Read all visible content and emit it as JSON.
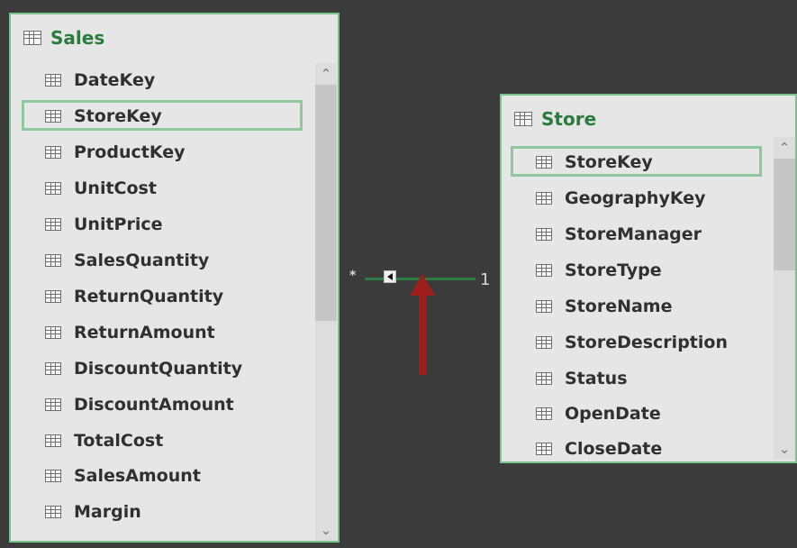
{
  "sales_table": {
    "title": "Sales",
    "fields": [
      {
        "label": "DateKey"
      },
      {
        "label": "StoreKey",
        "selected": true
      },
      {
        "label": "ProductKey"
      },
      {
        "label": "UnitCost"
      },
      {
        "label": "UnitPrice"
      },
      {
        "label": "SalesQuantity"
      },
      {
        "label": "ReturnQuantity"
      },
      {
        "label": "ReturnAmount"
      },
      {
        "label": "DiscountQuantity"
      },
      {
        "label": "DiscountAmount"
      },
      {
        "label": "TotalCost"
      },
      {
        "label": "SalesAmount"
      },
      {
        "label": "Margin"
      }
    ]
  },
  "store_table": {
    "title": "Store",
    "fields": [
      {
        "label": "StoreKey",
        "selected": true
      },
      {
        "label": "GeographyKey"
      },
      {
        "label": "StoreManager"
      },
      {
        "label": "StoreType"
      },
      {
        "label": "StoreName"
      },
      {
        "label": "StoreDescription"
      },
      {
        "label": "Status"
      },
      {
        "label": "OpenDate"
      },
      {
        "label": "CloseDate"
      }
    ]
  },
  "relationship": {
    "from_cardinality": "*",
    "to_cardinality": "1"
  },
  "icons": {
    "table": "table-grid-icon",
    "field": "field-grid-icon",
    "scroll_up": "chevron-up-icon",
    "scroll_down": "chevron-down-icon",
    "filter_direction": "filter-direction-icon",
    "annotation_arrow": "red-arrow-icon"
  },
  "colors": {
    "canvas": "#3b3b3b",
    "table_bg": "#e6e6e6",
    "accent_green": "#2b7b3e",
    "selection_green": "#8dc99d",
    "relationship_line": "#2e7b45",
    "annotation_arrow": "#9e1d1d"
  }
}
